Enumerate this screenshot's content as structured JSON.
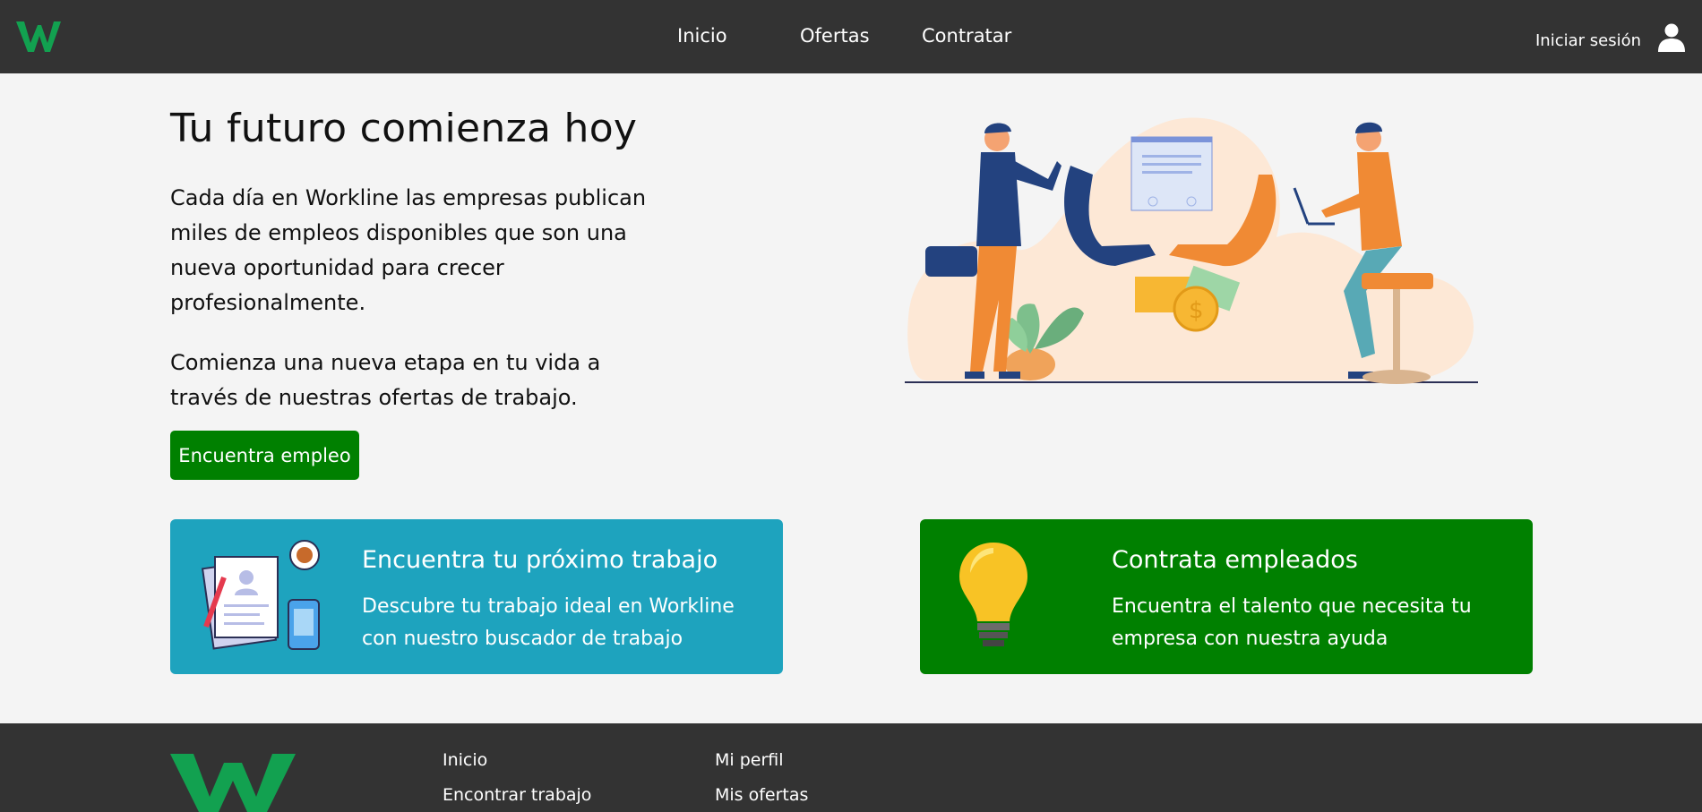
{
  "header": {
    "nav": {
      "inicio": "Inicio",
      "ofertas": "Ofertas",
      "contratar": "Contratar"
    },
    "login_label": "Iniciar sesión",
    "logo_icon": "workline-w-logo",
    "user_icon": "user-icon"
  },
  "hero": {
    "title": "Tu futuro comienza hoy",
    "paragraph1": "Cada día en Workline las empresas publican miles de empleos disponibles que son una nueva oportunidad para crecer profesionalmente.",
    "paragraph2": "Comienza una nueva etapa en tu vida a través de nuestras ofertas de trabajo.",
    "cta_label": "Encuentra empleo",
    "illustration": "handshake-illustration"
  },
  "cards": {
    "job": {
      "title": "Encuentra tu próximo trabajo",
      "text": "Descubre tu trabajo ideal en Workline con nuestro buscador de trabajo",
      "icon": "resume-documents-icon"
    },
    "hire": {
      "title": "Contrata empleados",
      "text": "Encuentra el talento que necesita tu empresa con nuestra ayuda",
      "icon": "lightbulb-icon"
    }
  },
  "footer": {
    "col1": [
      "Inicio",
      "Encontrar trabajo"
    ],
    "col2": [
      "Mi perfil",
      "Mis ofertas"
    ]
  },
  "colors": {
    "header_bg": "#333333",
    "brand_green": "#008000",
    "logo_green": "#12a150",
    "card_blue": "#1ea3be",
    "page_bg": "#f4f4f4"
  }
}
